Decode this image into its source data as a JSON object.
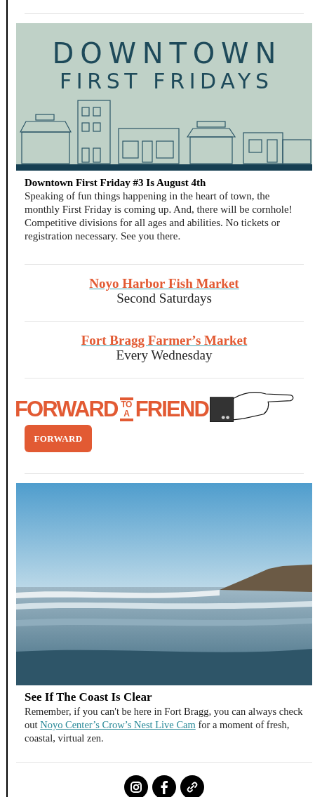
{
  "banner": {
    "title_line_1": "DOWNTOWN",
    "title_line_2": "FIRST FRIDAYS"
  },
  "event": {
    "title": "Downtown First Friday #3 Is August 4th",
    "body": "Speaking of fun things happening in the heart of town, the monthly First Friday is coming up. And, there will be cornhole! Competitive divisions for all ages and abilities. No tickets or registration necessary. See you there."
  },
  "markets": [
    {
      "name": "Noyo Harbor Fish Market",
      "schedule": "Second Saturdays"
    },
    {
      "name": "Fort Bragg Farmer’s Market",
      "schedule": "Every Wednesday"
    }
  ],
  "forward": {
    "word_1": "FORWARD",
    "small_1": "TO",
    "small_2": "A",
    "word_2": "FRIEND",
    "button": "FORWARD"
  },
  "coast": {
    "kind": "picture",
    "title": "See If The Coast Is Clear",
    "body_before": "Remember, if you can't be here in Fort Bragg, you can always check out ",
    "link": "Noyo Center’s Crow’s Nest Live Cam",
    "body_after": " for a moment of fresh, coastal, virtual zen."
  },
  "social": [
    {
      "kind": "instagram"
    },
    {
      "kind": "facebook"
    },
    {
      "kind": "link"
    }
  ]
}
